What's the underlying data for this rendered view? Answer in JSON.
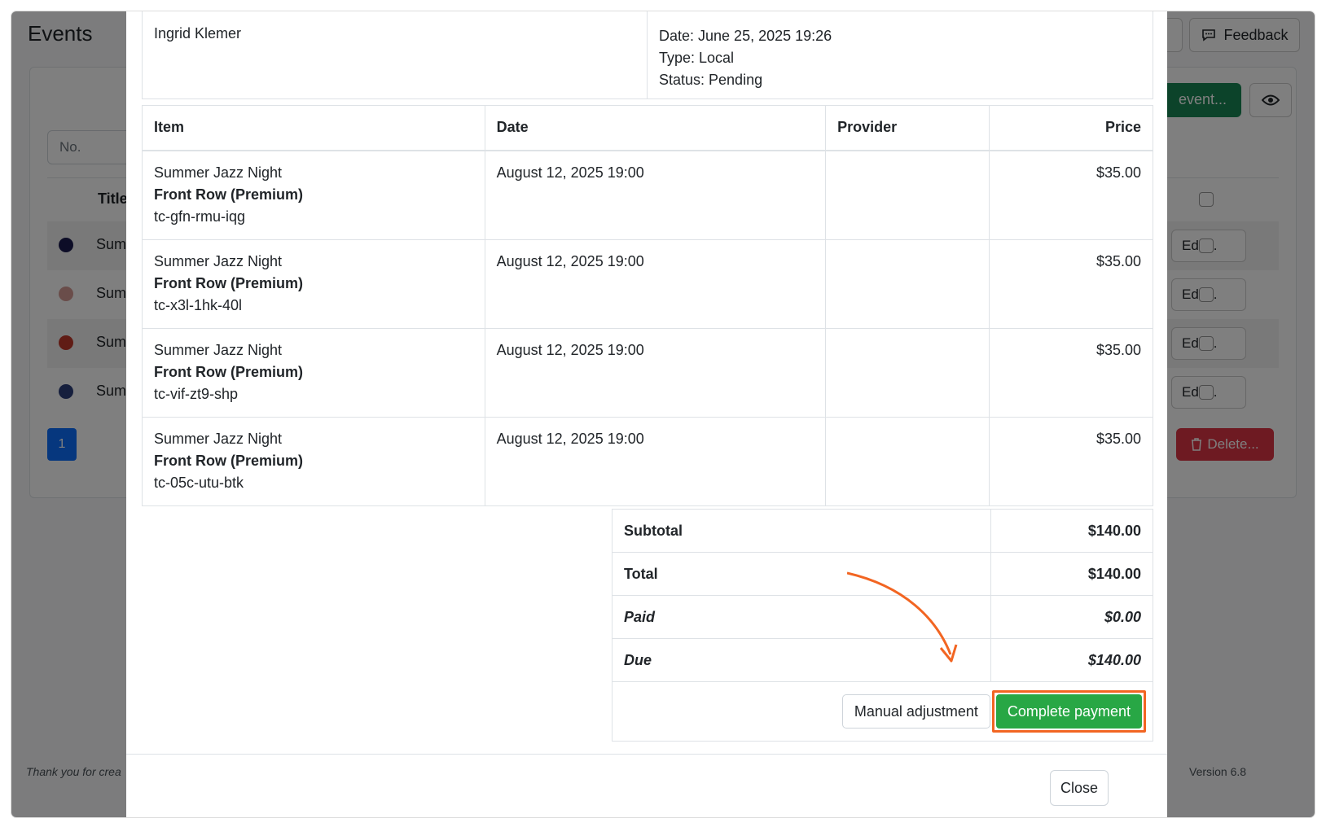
{
  "background": {
    "app_title": "Events",
    "feedback_label": "Feedback",
    "search_placeholder": "No.",
    "add_event_label": "event...",
    "title_header": "Title",
    "rows": [
      {
        "title": "Sum",
        "dot_color": "#1a1a4e",
        "edit": "Edit..."
      },
      {
        "title": "Sum",
        "dot_color": "#d49a94",
        "edit": "Edit..."
      },
      {
        "title": "Sum",
        "dot_color": "#c0392b",
        "edit": "Edit..."
      },
      {
        "title": "Sum",
        "dot_color": "#2c3e7a",
        "edit": "Edit..."
      }
    ],
    "page_number": "1",
    "delete_label": "Delete...",
    "footer_left": "Thank you for crea",
    "footer_right": "Version 6.8"
  },
  "modal": {
    "customer_name": "Ingrid Klemer",
    "order_date": "Date: June 25, 2025 19:26",
    "order_type": "Type: Local",
    "order_status": "Status: Pending",
    "columns": {
      "item": "Item",
      "date": "Date",
      "provider": "Provider",
      "price": "Price"
    },
    "items": [
      {
        "event": "Summer Jazz Night",
        "seat": "Front Row (Premium)",
        "code": "tc-gfn-rmu-iqg",
        "date": "August 12, 2025 19:00",
        "provider": "",
        "price": "$35.00"
      },
      {
        "event": "Summer Jazz Night",
        "seat": "Front Row (Premium)",
        "code": "tc-x3l-1hk-40l",
        "date": "August 12, 2025 19:00",
        "provider": "",
        "price": "$35.00"
      },
      {
        "event": "Summer Jazz Night",
        "seat": "Front Row (Premium)",
        "code": "tc-vif-zt9-shp",
        "date": "August 12, 2025 19:00",
        "provider": "",
        "price": "$35.00"
      },
      {
        "event": "Summer Jazz Night",
        "seat": "Front Row (Premium)",
        "code": "tc-05c-utu-btk",
        "date": "August 12, 2025 19:00",
        "provider": "",
        "price": "$35.00"
      }
    ],
    "totals": {
      "subtotal_label": "Subtotal",
      "subtotal": "$140.00",
      "total_label": "Total",
      "total": "$140.00",
      "paid_label": "Paid",
      "paid": "$0.00",
      "due_label": "Due",
      "due": "$140.00"
    },
    "manual_adjustment_label": "Manual adjustment",
    "complete_payment_label": "Complete payment",
    "close_label": "Close"
  },
  "colors": {
    "accent_green": "#28a745",
    "highlight_orange": "#f26522"
  }
}
